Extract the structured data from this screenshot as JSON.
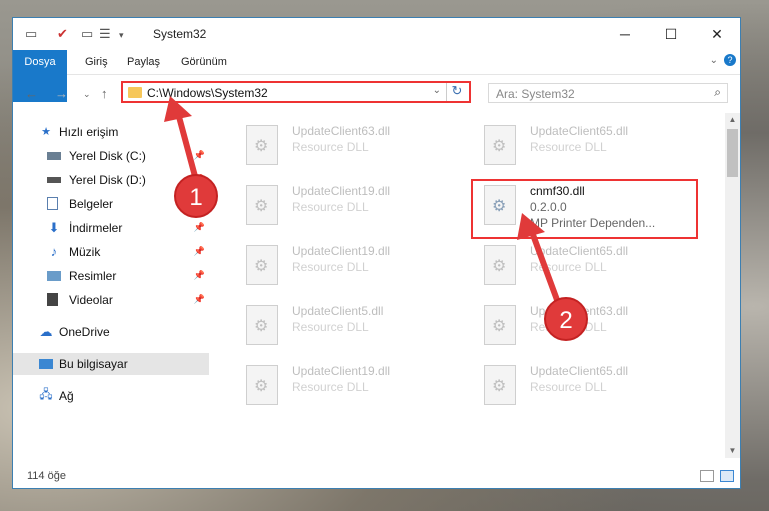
{
  "window": {
    "title": "System32"
  },
  "ribbon": {
    "tabs": [
      "Dosya",
      "Giriş",
      "Paylaş",
      "Görünüm"
    ]
  },
  "address": {
    "path": "C:\\Windows\\System32"
  },
  "search": {
    "placeholder": "Ara: System32"
  },
  "sidebar": {
    "items": [
      {
        "label": "Hızlı erişim",
        "icon": "star-icon",
        "pinned": false
      },
      {
        "label": "Yerel Disk (C:)",
        "icon": "drive-icon",
        "pinned": true
      },
      {
        "label": "Yerel Disk (D:)",
        "icon": "drive-icon",
        "pinned": true
      },
      {
        "label": "Belgeler",
        "icon": "documents-icon",
        "pinned": true
      },
      {
        "label": "İndirmeler",
        "icon": "download-icon",
        "pinned": true
      },
      {
        "label": "Müzik",
        "icon": "music-icon",
        "pinned": true
      },
      {
        "label": "Resimler",
        "icon": "pictures-icon",
        "pinned": true
      },
      {
        "label": "Videolar",
        "icon": "videos-icon",
        "pinned": true
      },
      {
        "label": "OneDrive",
        "icon": "onedrive-icon",
        "pinned": false
      },
      {
        "label": "Bu bilgisayar",
        "icon": "computer-icon",
        "pinned": false
      },
      {
        "label": "Ağ",
        "icon": "network-icon",
        "pinned": false
      }
    ]
  },
  "files": [
    {
      "name": "UpdateClient63.dll",
      "desc": "Resource DLL"
    },
    {
      "name": "UpdateClient65.dll",
      "desc": "Resource DLL"
    },
    {
      "name": "UpdateClient19.dll",
      "desc": "Resource DLL"
    },
    {
      "name": "cnmf30.dll",
      "desc": "0.2.0.0",
      "desc2": "MP Printer Dependen..."
    },
    {
      "name": "UpdateClient19.dll",
      "desc": "Resource DLL"
    },
    {
      "name": "UpdateClient65.dll",
      "desc": "Resource DLL"
    },
    {
      "name": "UpdateClient5.dll",
      "desc": "Resource DLL"
    },
    {
      "name": "UpdateClient63.dll",
      "desc": "Resource DLL"
    },
    {
      "name": "UpdateClient19.dll",
      "desc": "Resource DLL"
    },
    {
      "name": "UpdateClient65.dll",
      "desc": "Resource DLL"
    }
  ],
  "status": {
    "count": "114 öğe"
  },
  "callouts": [
    "1",
    "2"
  ],
  "colors": {
    "accent": "#1979ca",
    "highlight": "#e33333",
    "callout": "#e03a3a"
  }
}
